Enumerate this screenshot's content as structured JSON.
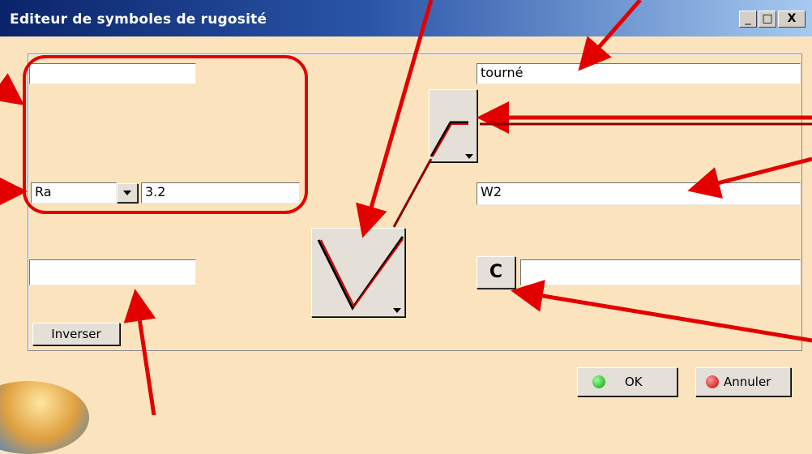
{
  "window": {
    "title": "Editeur de symboles de rugosité",
    "controls": [
      "_",
      "□",
      "X"
    ]
  },
  "left": {
    "top_field_value": "",
    "param_select_value": "Ra",
    "param_value": "3.2",
    "bottom_field_value": "",
    "invert_label": "Inverser"
  },
  "right": {
    "process_value": "tourné",
    "waviness_value": "W2",
    "c_button_label": "C",
    "c_field_value": ""
  },
  "footer": {
    "ok_label": "OK",
    "cancel_label": "Annuler"
  },
  "colors": {
    "annotation_red": "#e30000",
    "background": "#fbe4bd",
    "title_blue": "#0a246a"
  }
}
